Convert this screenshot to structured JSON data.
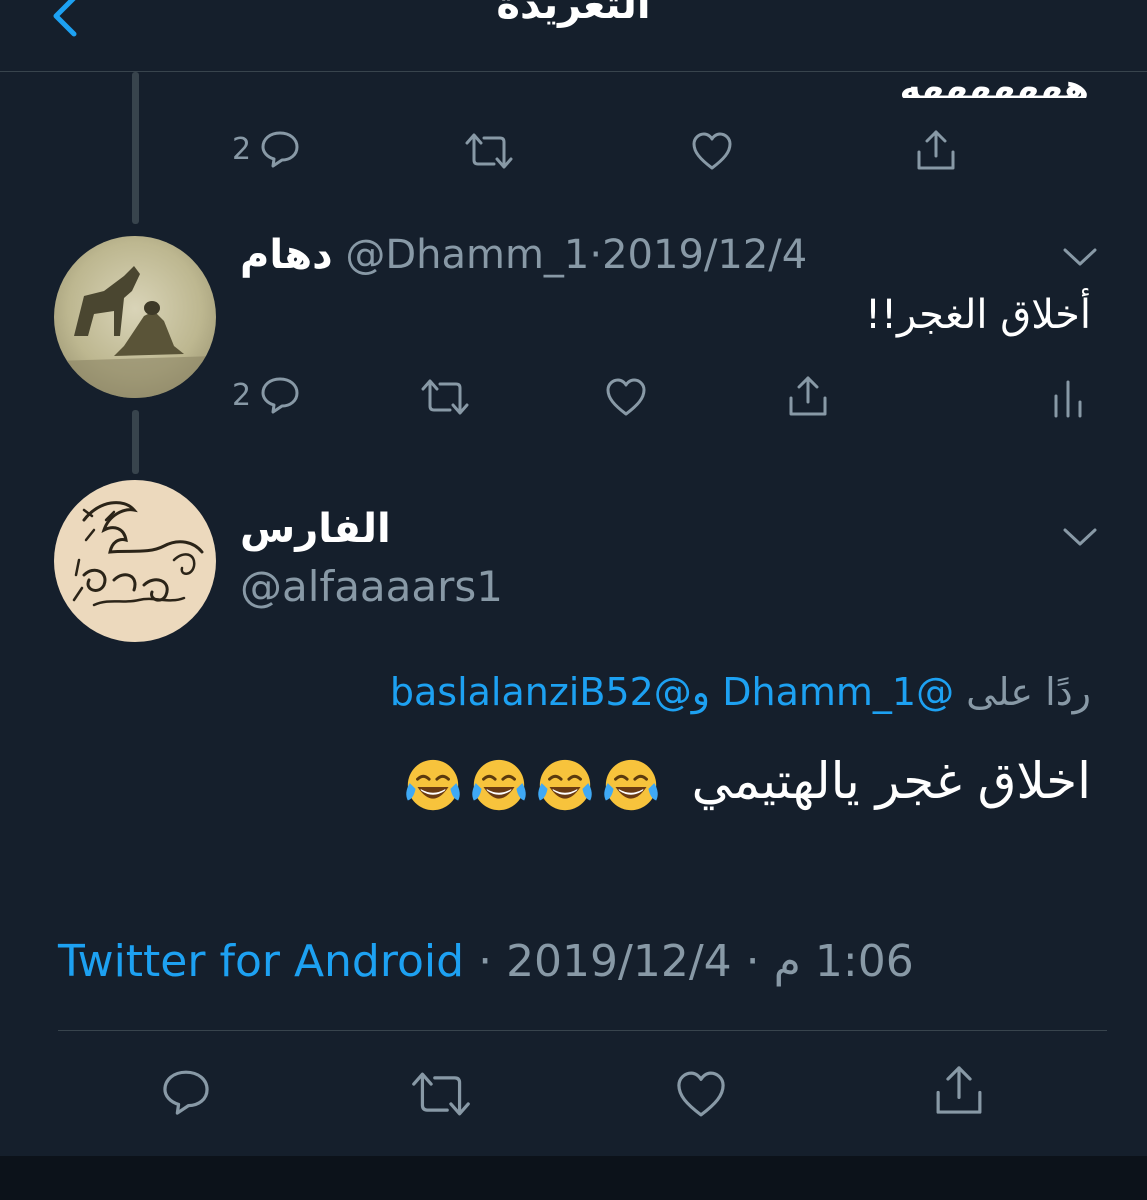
{
  "header": {
    "title": "التغريدة"
  },
  "previous_tweet": {
    "text_tail": "هههههههه",
    "actions": {
      "reply_count": "2"
    }
  },
  "parent_tweet": {
    "name": "دهام",
    "handle": "@Dhamm_1",
    "separator": "·",
    "date": "2019/12/4",
    "text": "أخلاق الغجر!!",
    "actions": {
      "reply_count": "2"
    }
  },
  "main_tweet": {
    "name": "الفارس",
    "handle": "@alfaaaars1",
    "reply_prefix": "ردًا على",
    "reply_user_1": "@Dhamm_1",
    "reply_and": "و",
    "reply_user_2": "@baslalanziB52",
    "text": "اخلاق غجر يالهتيمي",
    "emoji_count": 4,
    "source": "Twitter for Android",
    "separator": "·",
    "date": "2019/12/4",
    "time": "1:06 م"
  },
  "colors": {
    "background": "#151f2c",
    "accent": "#1da1f2",
    "muted": "#8899a6",
    "divider": "#38444d"
  },
  "icons": [
    "chevron-left-icon",
    "reply-icon",
    "retweet-icon",
    "like-icon",
    "share-icon",
    "analytics-icon",
    "chevron-down-icon",
    "tears-of-joy-emoji"
  ]
}
